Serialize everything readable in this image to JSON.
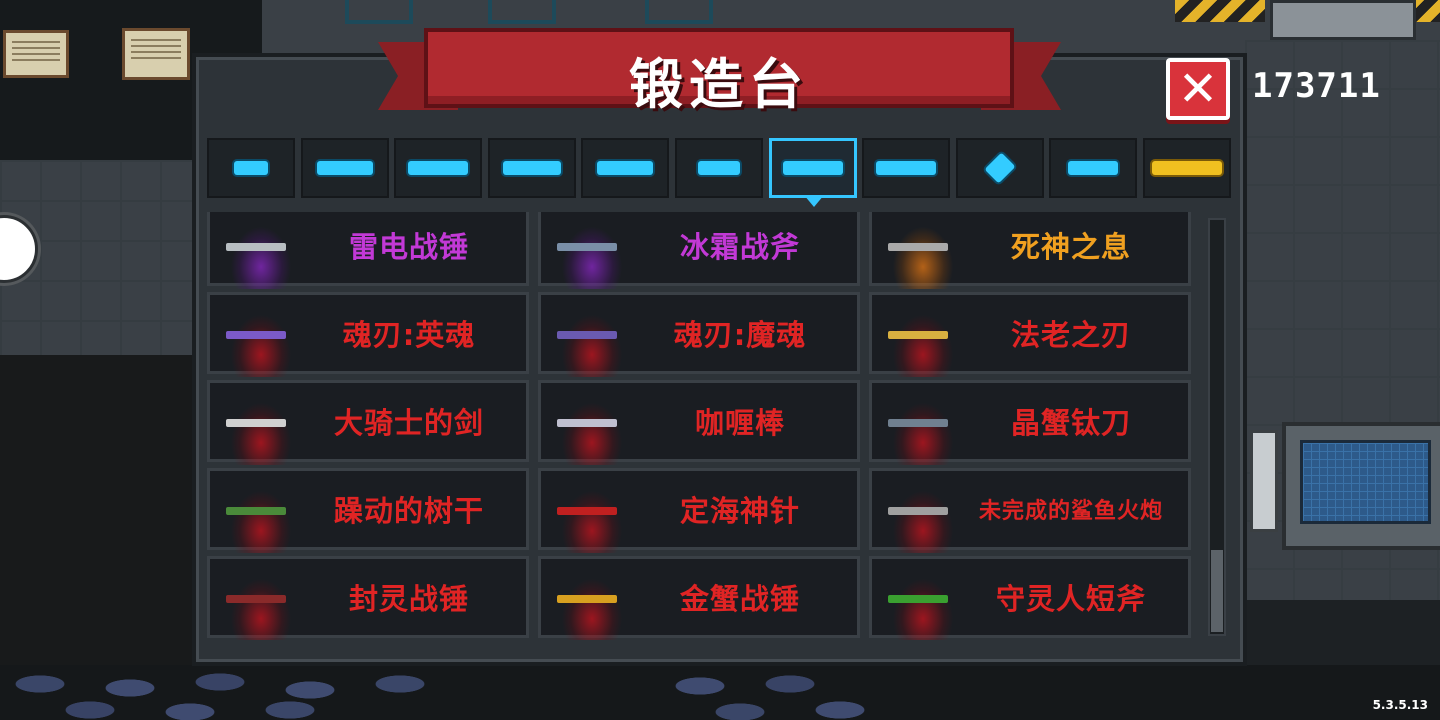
{
  "title": "锻造台",
  "hud": {
    "score": "173711",
    "version": "5.3.5.13"
  },
  "close_icon": "close-x-icon",
  "colors": {
    "accent": "#35c6ff",
    "label_red": "#e02424",
    "label_magenta": "#c239d6",
    "label_orange": "#f0a020",
    "ribbon": "#b12a30"
  },
  "tabs": [
    {
      "icon": "pistol-icon",
      "active": false
    },
    {
      "icon": "rifle-icon",
      "active": false
    },
    {
      "icon": "shotgun-icon",
      "active": false
    },
    {
      "icon": "launcher-icon",
      "active": false
    },
    {
      "icon": "laser-gun-icon",
      "active": false
    },
    {
      "icon": "bow-icon",
      "active": false
    },
    {
      "icon": "sword-icon",
      "active": true
    },
    {
      "icon": "spear-icon",
      "active": false
    },
    {
      "icon": "shuriken-icon",
      "active": false
    },
    {
      "icon": "fish-icon",
      "active": false
    },
    {
      "icon": "crown-icon",
      "active": false
    }
  ],
  "items": [
    {
      "name": "雷电战锤",
      "color": "#c239d6",
      "glow": "purple"
    },
    {
      "name": "冰霜战斧",
      "color": "#c239d6",
      "glow": "purple"
    },
    {
      "name": "死神之息",
      "color": "#f0a020",
      "glow": "orange"
    },
    {
      "name": "魂刃:英魂",
      "color": "#e02424",
      "glow": "red"
    },
    {
      "name": "魂刃:魔魂",
      "color": "#e02424",
      "glow": "red"
    },
    {
      "name": "法老之刃",
      "color": "#e02424",
      "glow": "red"
    },
    {
      "name": "大骑士的剑",
      "color": "#e02424",
      "glow": "red"
    },
    {
      "name": "咖喱棒",
      "color": "#e02424",
      "glow": "red"
    },
    {
      "name": "晶蟹钛刀",
      "color": "#e02424",
      "glow": "red"
    },
    {
      "name": "躁动的树干",
      "color": "#e02424",
      "glow": "red"
    },
    {
      "name": "定海神针",
      "color": "#e02424",
      "glow": "red"
    },
    {
      "name": "未完成的鲨鱼火炮",
      "color": "#e02424",
      "glow": "red"
    },
    {
      "name": "封灵战锤",
      "color": "#e02424",
      "glow": "red"
    },
    {
      "name": "金蟹战锤",
      "color": "#e02424",
      "glow": "red"
    },
    {
      "name": "守灵人短斧",
      "color": "#e02424",
      "glow": "red"
    }
  ]
}
